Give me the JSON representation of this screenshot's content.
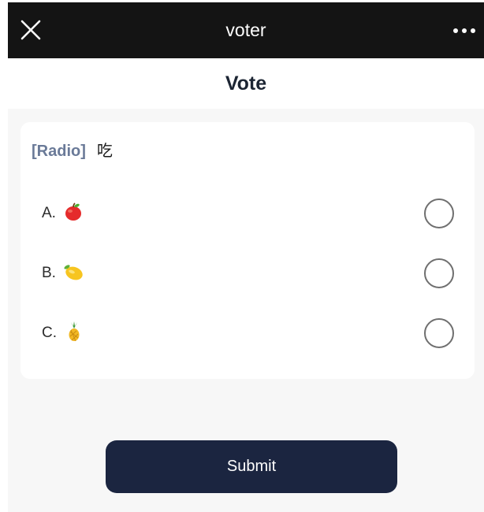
{
  "window": {
    "title": "voter"
  },
  "page": {
    "title": "Vote"
  },
  "question": {
    "tag": "[Radio]",
    "text": "吃"
  },
  "options": [
    {
      "letter": "A.",
      "icon": "apple-icon",
      "selected": false
    },
    {
      "letter": "B.",
      "icon": "lemon-icon",
      "selected": false
    },
    {
      "letter": "C.",
      "icon": "pineapple-icon",
      "selected": false
    }
  ],
  "actions": {
    "submit_label": "Submit"
  },
  "colors": {
    "topbar": "#141414",
    "background": "#f7f7f7",
    "button": "#1b2540",
    "tag": "#6a7a98",
    "radio_border": "#6f6f6f"
  }
}
